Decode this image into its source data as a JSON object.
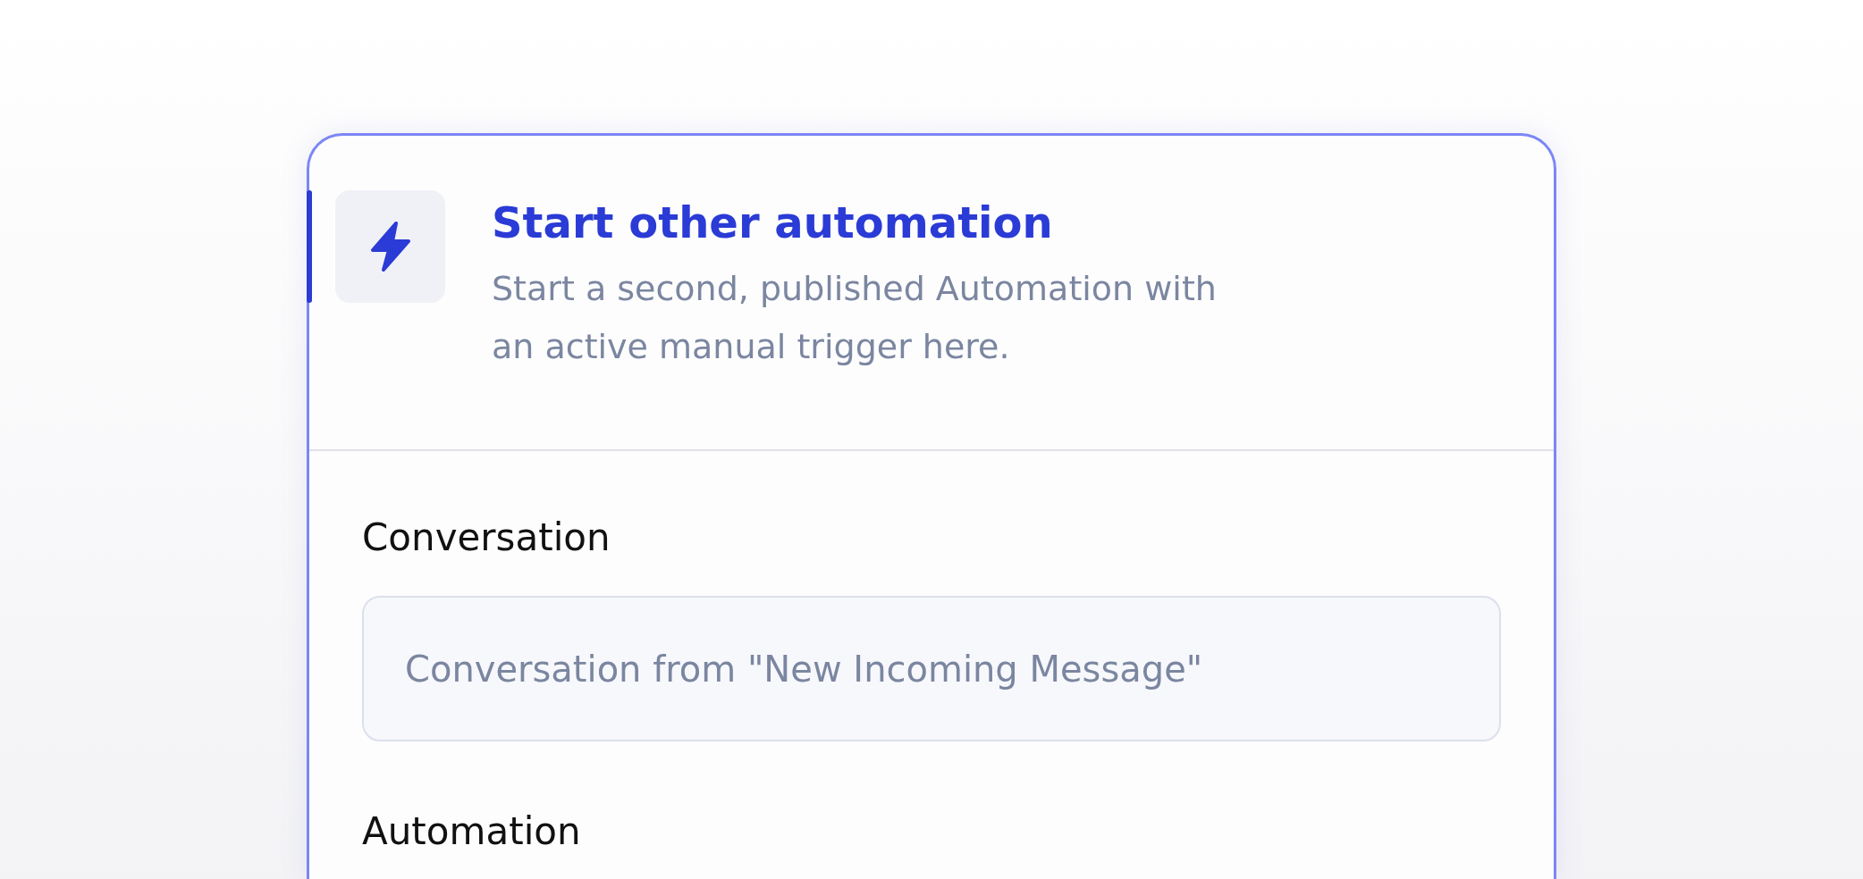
{
  "step": {
    "title": "Start other automation",
    "description": "Start a second, published Automation with an active manual trigger here."
  },
  "fields": [
    {
      "label": "Conversation",
      "value": "Conversation from \"New Incoming Message\""
    },
    {
      "label": "Automation"
    }
  ]
}
